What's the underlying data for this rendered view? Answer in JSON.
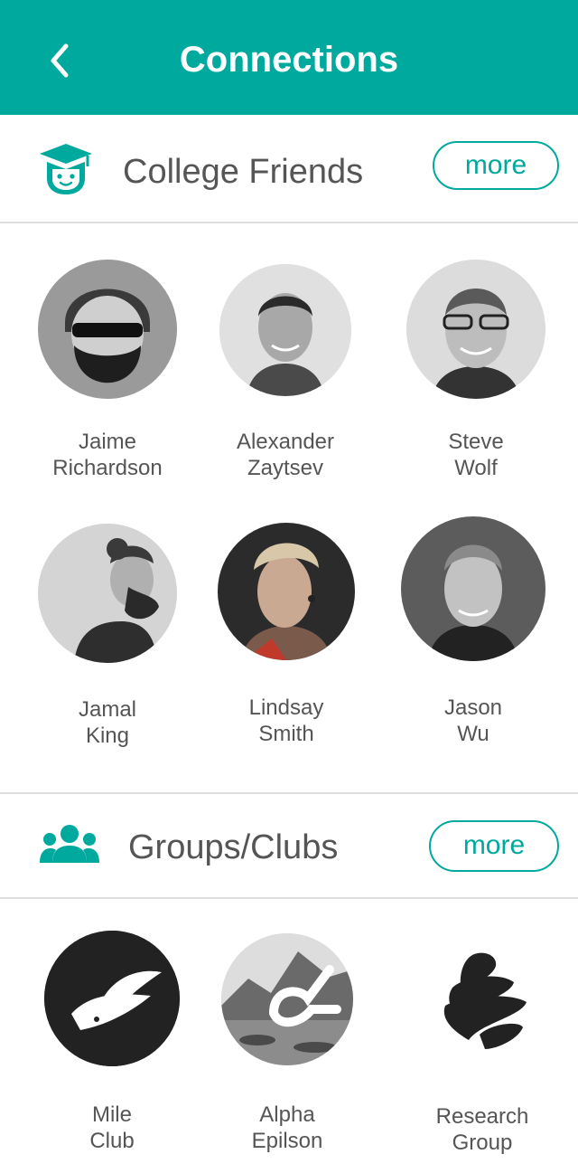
{
  "header": {
    "title": "Connections",
    "back_icon": "chevron-left-icon",
    "background": "#00a99d"
  },
  "accent": "#00a99d",
  "college_friends": {
    "title": "College Friends",
    "icon": "graduate-icon",
    "more_label": "more",
    "people": [
      {
        "first": "Jaime",
        "last": "Richardson"
      },
      {
        "first": "Alexander",
        "last": "Zaytsev"
      },
      {
        "first": "Steve",
        "last": "Wolf"
      },
      {
        "first": "Jamal",
        "last": "King"
      },
      {
        "first": "Lindsay",
        "last": "Smith"
      },
      {
        "first": "Jason",
        "last": "Wu"
      }
    ]
  },
  "groups_clubs": {
    "title": "Groups/Clubs",
    "icon": "group-icon",
    "more_label": "more",
    "groups": [
      {
        "line1": "Mile",
        "line2": "Club"
      },
      {
        "line1": "Alpha",
        "line2": "Epilson"
      },
      {
        "line1": "Research",
        "line2": "Group"
      }
    ]
  }
}
